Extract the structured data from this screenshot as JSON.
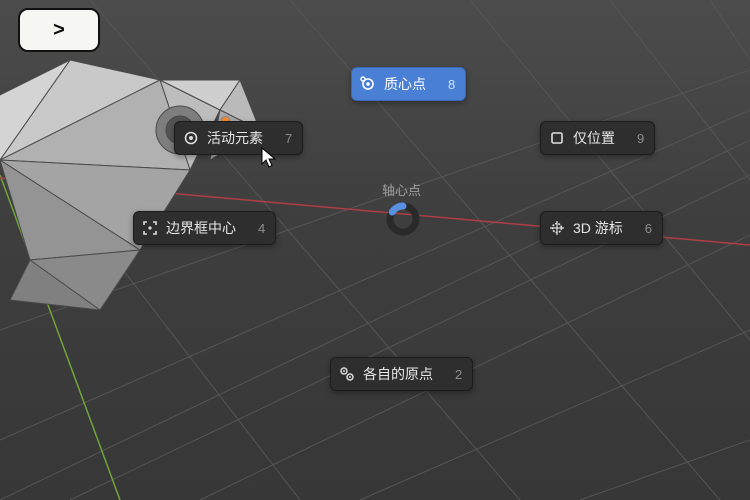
{
  "topKey": ">",
  "centerLabel": "轴心点",
  "menu": {
    "medianPoint": {
      "label": "质心点",
      "key": "8"
    },
    "activeElement": {
      "label": "活动元素",
      "key": "7"
    },
    "onlyLocation": {
      "label": "仅位置",
      "key": "9"
    },
    "bboxCenter": {
      "label": "边界框中心",
      "key": "4"
    },
    "cursor3d": {
      "label": "3D 游标",
      "key": "6"
    },
    "individual": {
      "label": "各自的原点",
      "key": "2"
    }
  },
  "colors": {
    "accent": "#4a7fd6",
    "axisX": "#b03d45",
    "axisY": "#6fa53a"
  }
}
